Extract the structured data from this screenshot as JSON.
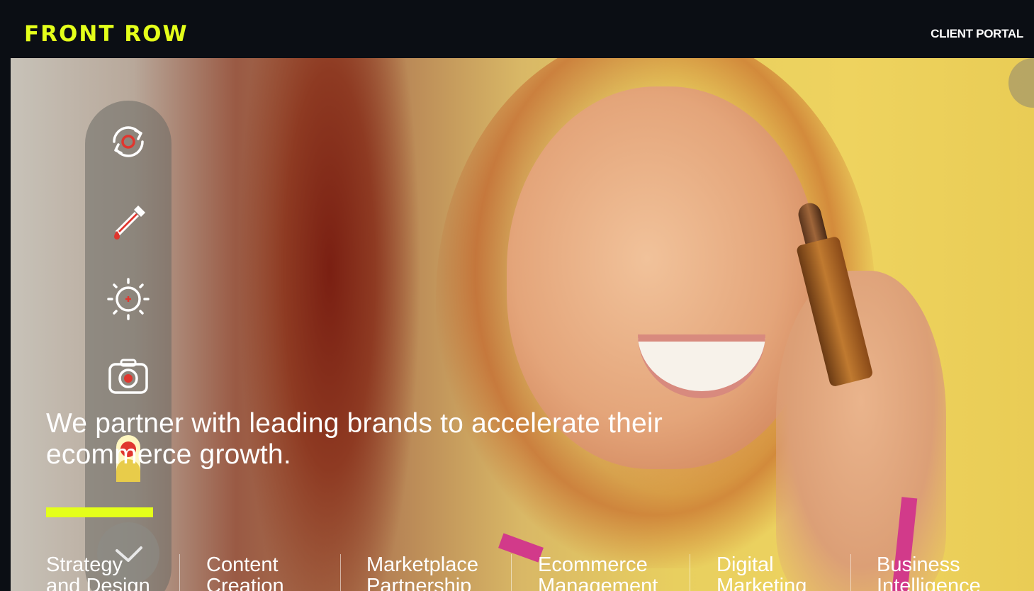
{
  "brand": {
    "logo_text": "FRONT ROW",
    "accent_color": "#e4ff1a",
    "bg_color": "#0b0e14"
  },
  "header": {
    "client_portal_label": "CLIENT PORTAL"
  },
  "hero": {
    "headline_line1": "We partner with leading brands to accelerate their",
    "headline_line2": "ecommerce growth.",
    "toolbar_icons": [
      "rotate-icon",
      "eyedropper-icon",
      "brightness-icon",
      "camera-icon",
      "toggle-icon",
      "check-icon"
    ]
  },
  "services": [
    {
      "line1": "Strategy",
      "line2": "and Design"
    },
    {
      "line1": "Content",
      "line2": "Creation"
    },
    {
      "line1": "Marketplace",
      "line2": "Partnership"
    },
    {
      "line1": "Ecommerce",
      "line2": "Management"
    },
    {
      "line1": "Digital",
      "line2": "Marketing"
    },
    {
      "line1": "Business",
      "line2": "Intelligence"
    }
  ]
}
